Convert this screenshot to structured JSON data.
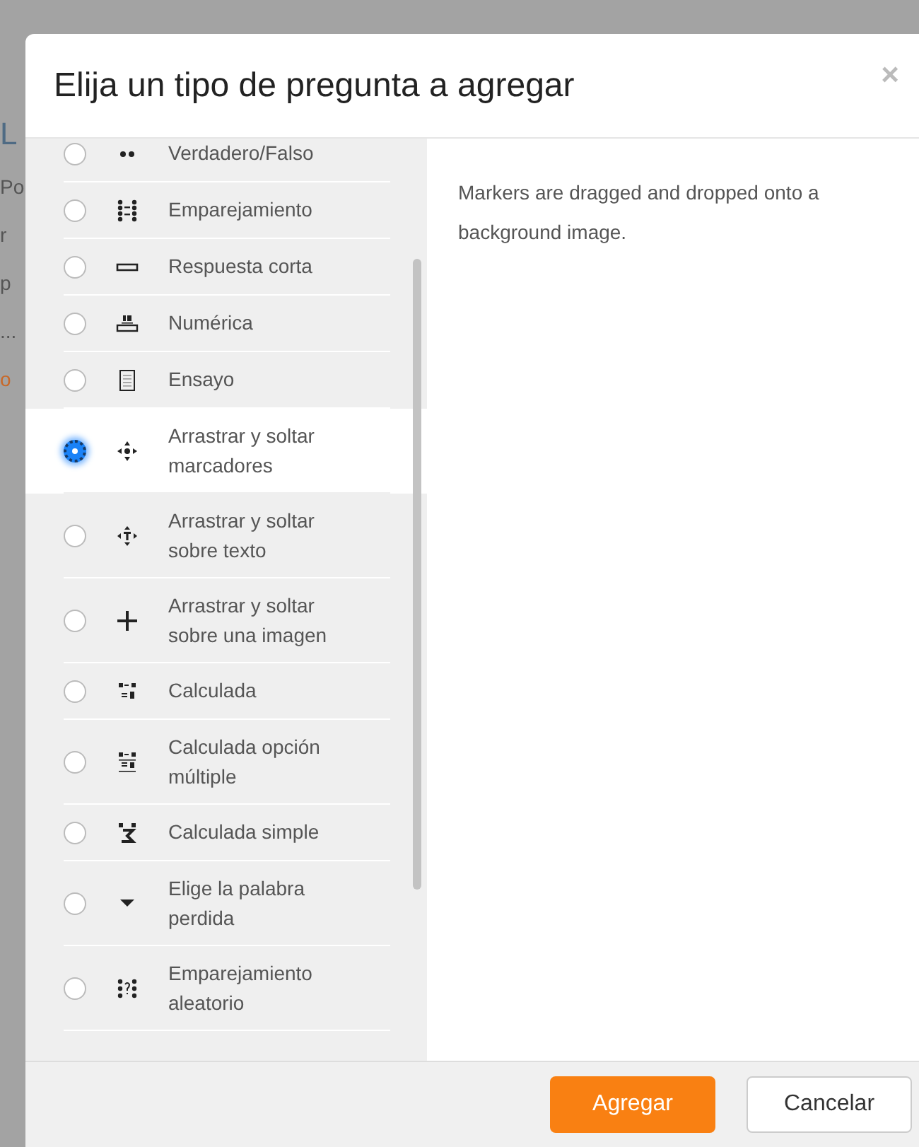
{
  "background_page": {
    "fragments": [
      {
        "text": "L",
        "color": "#4f6b84"
      },
      {
        "text": "Po",
        "color": "#555555"
      },
      {
        "text": "r",
        "color": "#555555"
      },
      {
        "text": "p",
        "color": "#555555"
      },
      {
        "text": "...",
        "color": "#555555"
      },
      {
        "text": "o",
        "color": "#c8692a"
      }
    ]
  },
  "dialog": {
    "title": "Elija un tipo de pregunta a agregar",
    "close": "×",
    "options": [
      {
        "label": "Verdadero/Falso",
        "selected": false
      },
      {
        "label": "Emparejamiento",
        "selected": false
      },
      {
        "label": "Respuesta corta",
        "selected": false
      },
      {
        "label": "Numérica",
        "selected": false
      },
      {
        "label": "Ensayo",
        "selected": false
      },
      {
        "label": "Arrastrar y soltar marcadores",
        "selected": true
      },
      {
        "label": "Arrastrar y soltar sobre texto",
        "selected": false
      },
      {
        "label": "Arrastrar y soltar sobre una imagen",
        "selected": false
      },
      {
        "label": "Calculada",
        "selected": false
      },
      {
        "label": "Calculada opción múltiple",
        "selected": false
      },
      {
        "label": "Calculada simple",
        "selected": false
      },
      {
        "label": "Elige la palabra perdida",
        "selected": false
      },
      {
        "label": "Emparejamiento aleatorio",
        "selected": false
      }
    ],
    "description": "Markers are dragged and dropped onto a background image.",
    "buttons": [
      {
        "label": "Agregar",
        "kind": "primary"
      },
      {
        "label": "Cancelar",
        "kind": "secondary"
      }
    ]
  }
}
